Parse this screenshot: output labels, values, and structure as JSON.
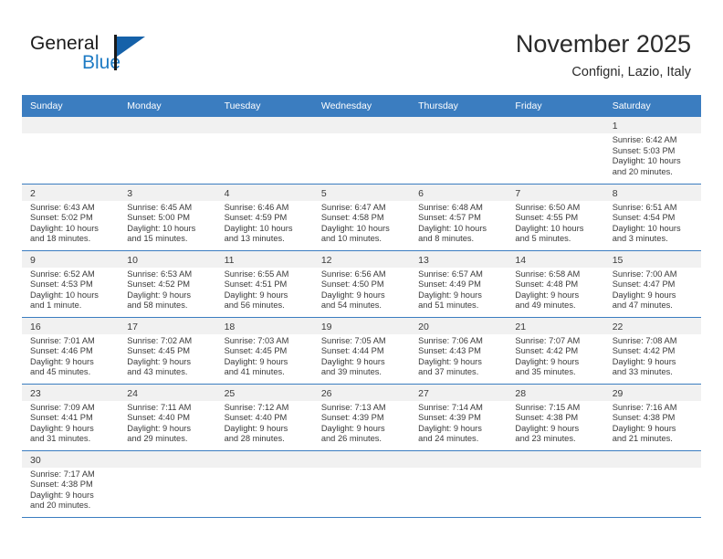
{
  "brand": {
    "name_part1": "General",
    "name_part2": "Blue",
    "logo_icon": "blue-triangle-flag-icon",
    "accent_color": "#1561a9"
  },
  "header": {
    "title": "November 2025",
    "subtitle": "Configni, Lazio, Italy",
    "header_bg_color": "#3b7dc0",
    "daynum_bg_color": "#f1f1f1"
  },
  "weekday_headers": [
    "Sunday",
    "Monday",
    "Tuesday",
    "Wednesday",
    "Thursday",
    "Friday",
    "Saturday"
  ],
  "labels": {
    "sunrise": "Sunrise:",
    "sunset": "Sunset:",
    "daylight": "Daylight:"
  },
  "weeks": [
    [
      {
        "day": "",
        "blank": true
      },
      {
        "day": "",
        "blank": true
      },
      {
        "day": "",
        "blank": true
      },
      {
        "day": "",
        "blank": true
      },
      {
        "day": "",
        "blank": true
      },
      {
        "day": "",
        "blank": true
      },
      {
        "day": "1",
        "sunrise": "Sunrise: 6:42 AM",
        "sunset": "Sunset: 5:03 PM",
        "daylight_l1": "Daylight: 10 hours",
        "daylight_l2": "and 20 minutes."
      }
    ],
    [
      {
        "day": "2",
        "sunrise": "Sunrise: 6:43 AM",
        "sunset": "Sunset: 5:02 PM",
        "daylight_l1": "Daylight: 10 hours",
        "daylight_l2": "and 18 minutes."
      },
      {
        "day": "3",
        "sunrise": "Sunrise: 6:45 AM",
        "sunset": "Sunset: 5:00 PM",
        "daylight_l1": "Daylight: 10 hours",
        "daylight_l2": "and 15 minutes."
      },
      {
        "day": "4",
        "sunrise": "Sunrise: 6:46 AM",
        "sunset": "Sunset: 4:59 PM",
        "daylight_l1": "Daylight: 10 hours",
        "daylight_l2": "and 13 minutes."
      },
      {
        "day": "5",
        "sunrise": "Sunrise: 6:47 AM",
        "sunset": "Sunset: 4:58 PM",
        "daylight_l1": "Daylight: 10 hours",
        "daylight_l2": "and 10 minutes."
      },
      {
        "day": "6",
        "sunrise": "Sunrise: 6:48 AM",
        "sunset": "Sunset: 4:57 PM",
        "daylight_l1": "Daylight: 10 hours",
        "daylight_l2": "and 8 minutes."
      },
      {
        "day": "7",
        "sunrise": "Sunrise: 6:50 AM",
        "sunset": "Sunset: 4:55 PM",
        "daylight_l1": "Daylight: 10 hours",
        "daylight_l2": "and 5 minutes."
      },
      {
        "day": "8",
        "sunrise": "Sunrise: 6:51 AM",
        "sunset": "Sunset: 4:54 PM",
        "daylight_l1": "Daylight: 10 hours",
        "daylight_l2": "and 3 minutes."
      }
    ],
    [
      {
        "day": "9",
        "sunrise": "Sunrise: 6:52 AM",
        "sunset": "Sunset: 4:53 PM",
        "daylight_l1": "Daylight: 10 hours",
        "daylight_l2": "and 1 minute."
      },
      {
        "day": "10",
        "sunrise": "Sunrise: 6:53 AM",
        "sunset": "Sunset: 4:52 PM",
        "daylight_l1": "Daylight: 9 hours",
        "daylight_l2": "and 58 minutes."
      },
      {
        "day": "11",
        "sunrise": "Sunrise: 6:55 AM",
        "sunset": "Sunset: 4:51 PM",
        "daylight_l1": "Daylight: 9 hours",
        "daylight_l2": "and 56 minutes."
      },
      {
        "day": "12",
        "sunrise": "Sunrise: 6:56 AM",
        "sunset": "Sunset: 4:50 PM",
        "daylight_l1": "Daylight: 9 hours",
        "daylight_l2": "and 54 minutes."
      },
      {
        "day": "13",
        "sunrise": "Sunrise: 6:57 AM",
        "sunset": "Sunset: 4:49 PM",
        "daylight_l1": "Daylight: 9 hours",
        "daylight_l2": "and 51 minutes."
      },
      {
        "day": "14",
        "sunrise": "Sunrise: 6:58 AM",
        "sunset": "Sunset: 4:48 PM",
        "daylight_l1": "Daylight: 9 hours",
        "daylight_l2": "and 49 minutes."
      },
      {
        "day": "15",
        "sunrise": "Sunrise: 7:00 AM",
        "sunset": "Sunset: 4:47 PM",
        "daylight_l1": "Daylight: 9 hours",
        "daylight_l2": "and 47 minutes."
      }
    ],
    [
      {
        "day": "16",
        "sunrise": "Sunrise: 7:01 AM",
        "sunset": "Sunset: 4:46 PM",
        "daylight_l1": "Daylight: 9 hours",
        "daylight_l2": "and 45 minutes."
      },
      {
        "day": "17",
        "sunrise": "Sunrise: 7:02 AM",
        "sunset": "Sunset: 4:45 PM",
        "daylight_l1": "Daylight: 9 hours",
        "daylight_l2": "and 43 minutes."
      },
      {
        "day": "18",
        "sunrise": "Sunrise: 7:03 AM",
        "sunset": "Sunset: 4:45 PM",
        "daylight_l1": "Daylight: 9 hours",
        "daylight_l2": "and 41 minutes."
      },
      {
        "day": "19",
        "sunrise": "Sunrise: 7:05 AM",
        "sunset": "Sunset: 4:44 PM",
        "daylight_l1": "Daylight: 9 hours",
        "daylight_l2": "and 39 minutes."
      },
      {
        "day": "20",
        "sunrise": "Sunrise: 7:06 AM",
        "sunset": "Sunset: 4:43 PM",
        "daylight_l1": "Daylight: 9 hours",
        "daylight_l2": "and 37 minutes."
      },
      {
        "day": "21",
        "sunrise": "Sunrise: 7:07 AM",
        "sunset": "Sunset: 4:42 PM",
        "daylight_l1": "Daylight: 9 hours",
        "daylight_l2": "and 35 minutes."
      },
      {
        "day": "22",
        "sunrise": "Sunrise: 7:08 AM",
        "sunset": "Sunset: 4:42 PM",
        "daylight_l1": "Daylight: 9 hours",
        "daylight_l2": "and 33 minutes."
      }
    ],
    [
      {
        "day": "23",
        "sunrise": "Sunrise: 7:09 AM",
        "sunset": "Sunset: 4:41 PM",
        "daylight_l1": "Daylight: 9 hours",
        "daylight_l2": "and 31 minutes."
      },
      {
        "day": "24",
        "sunrise": "Sunrise: 7:11 AM",
        "sunset": "Sunset: 4:40 PM",
        "daylight_l1": "Daylight: 9 hours",
        "daylight_l2": "and 29 minutes."
      },
      {
        "day": "25",
        "sunrise": "Sunrise: 7:12 AM",
        "sunset": "Sunset: 4:40 PM",
        "daylight_l1": "Daylight: 9 hours",
        "daylight_l2": "and 28 minutes."
      },
      {
        "day": "26",
        "sunrise": "Sunrise: 7:13 AM",
        "sunset": "Sunset: 4:39 PM",
        "daylight_l1": "Daylight: 9 hours",
        "daylight_l2": "and 26 minutes."
      },
      {
        "day": "27",
        "sunrise": "Sunrise: 7:14 AM",
        "sunset": "Sunset: 4:39 PM",
        "daylight_l1": "Daylight: 9 hours",
        "daylight_l2": "and 24 minutes."
      },
      {
        "day": "28",
        "sunrise": "Sunrise: 7:15 AM",
        "sunset": "Sunset: 4:38 PM",
        "daylight_l1": "Daylight: 9 hours",
        "daylight_l2": "and 23 minutes."
      },
      {
        "day": "29",
        "sunrise": "Sunrise: 7:16 AM",
        "sunset": "Sunset: 4:38 PM",
        "daylight_l1": "Daylight: 9 hours",
        "daylight_l2": "and 21 minutes."
      }
    ],
    [
      {
        "day": "30",
        "sunrise": "Sunrise: 7:17 AM",
        "sunset": "Sunset: 4:38 PM",
        "daylight_l1": "Daylight: 9 hours",
        "daylight_l2": "and 20 minutes."
      },
      {
        "day": "",
        "blank": true
      },
      {
        "day": "",
        "blank": true
      },
      {
        "day": "",
        "blank": true
      },
      {
        "day": "",
        "blank": true
      },
      {
        "day": "",
        "blank": true
      },
      {
        "day": "",
        "blank": true
      }
    ]
  ]
}
